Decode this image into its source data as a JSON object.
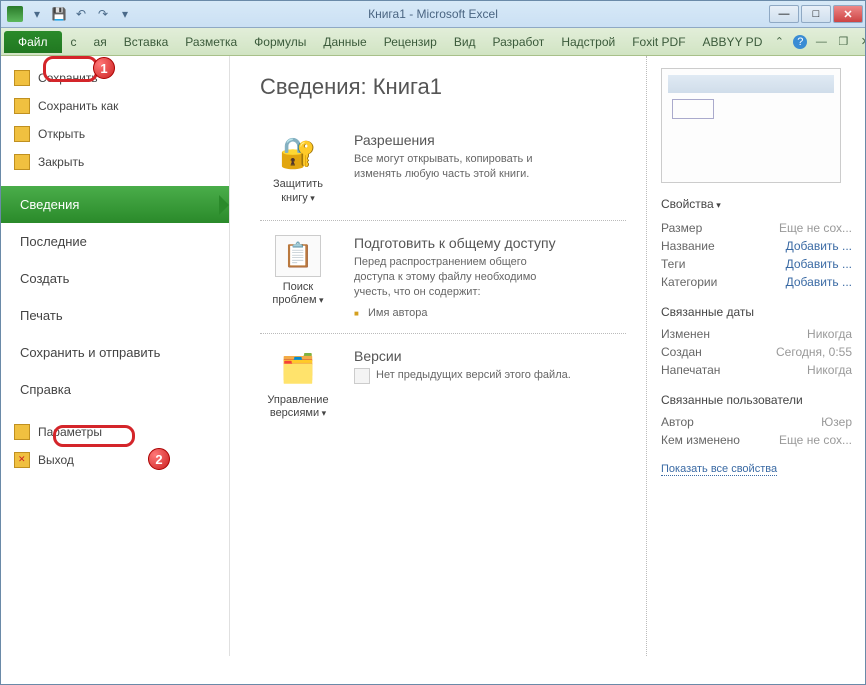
{
  "window": {
    "title": "Книга1 - Microsoft Excel"
  },
  "tabs": [
    "Файл",
    "с",
    "ая",
    "Вставка",
    "Разметка",
    "Формулы",
    "Данные",
    "Рецензир",
    "Вид",
    "Разработ",
    "Надстрой",
    "Foxit PDF",
    "ABBYY PD"
  ],
  "sidebar": {
    "save": "Сохранить",
    "saveas": "Сохранить как",
    "open": "Открыть",
    "close": "Закрыть",
    "info": "Сведения",
    "recent": "Последние",
    "new": "Создать",
    "print": "Печать",
    "share": "Сохранить и отправить",
    "help": "Справка",
    "options": "Параметры",
    "exit": "Выход"
  },
  "page": {
    "title": "Сведения: Книга1"
  },
  "perm": {
    "btn": "Защитить книгу",
    "hdr": "Разрешения",
    "desc": "Все могут открывать, копировать и изменять любую часть этой книги."
  },
  "prep": {
    "btn": "Поиск проблем",
    "hdr": "Подготовить к общему доступу",
    "desc": "Перед распространением общего доступа к этому файлу необходимо учесть, что он содержит:",
    "li1": "Имя автора"
  },
  "ver": {
    "btn": "Управление версиями",
    "hdr": "Версии",
    "desc": "Нет предыдущих версий этого файла."
  },
  "props": {
    "hdr": "Свойства",
    "rows": [
      {
        "k": "Размер",
        "v": "Еще не сох..."
      },
      {
        "k": "Название",
        "v": "Добавить ..."
      },
      {
        "k": "Теги",
        "v": "Добавить ..."
      },
      {
        "k": "Категории",
        "v": "Добавить ..."
      }
    ],
    "dates_hdr": "Связанные даты",
    "dates": [
      {
        "k": "Изменен",
        "v": "Никогда"
      },
      {
        "k": "Создан",
        "v": "Сегодня, 0:55"
      },
      {
        "k": "Напечатан",
        "v": "Никогда"
      }
    ],
    "users_hdr": "Связанные пользователи",
    "users": [
      {
        "k": "Автор",
        "v": "Юзер"
      },
      {
        "k": "Кем изменено",
        "v": "Еще не сох..."
      }
    ],
    "showall": "Показать все свойства"
  }
}
